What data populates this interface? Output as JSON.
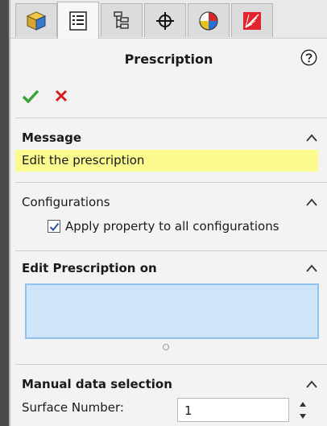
{
  "panel": {
    "title": "Prescription"
  },
  "tabs": [
    {
      "name": "feature-manager",
      "icon": "cube-icon"
    },
    {
      "name": "property-manager",
      "icon": "property-list-icon",
      "active": true
    },
    {
      "name": "configuration-manager",
      "icon": "configuration-tree-icon"
    },
    {
      "name": "dimxpert-manager",
      "icon": "crosshair-icon"
    },
    {
      "name": "display-manager",
      "icon": "color-wheel-icon"
    },
    {
      "name": "addin-manager",
      "icon": "lens-addin-icon"
    }
  ],
  "sections": {
    "message": {
      "title": "Message",
      "text": "Edit the prescription"
    },
    "configurations": {
      "title": "Configurations",
      "checkbox_label": "Apply property to all configurations",
      "checked": true
    },
    "edit_on": {
      "title": "Edit Prescription on"
    },
    "manual": {
      "title": "Manual data selection",
      "surface_label": "Surface Number:",
      "surface_value": "1"
    }
  },
  "colors": {
    "ok_green": "#3aa23a",
    "cancel_red": "#d61f1f",
    "message_bg": "#fafa8f",
    "selection_bg": "#cfe4f8",
    "selection_border": "#8ec3ef"
  }
}
